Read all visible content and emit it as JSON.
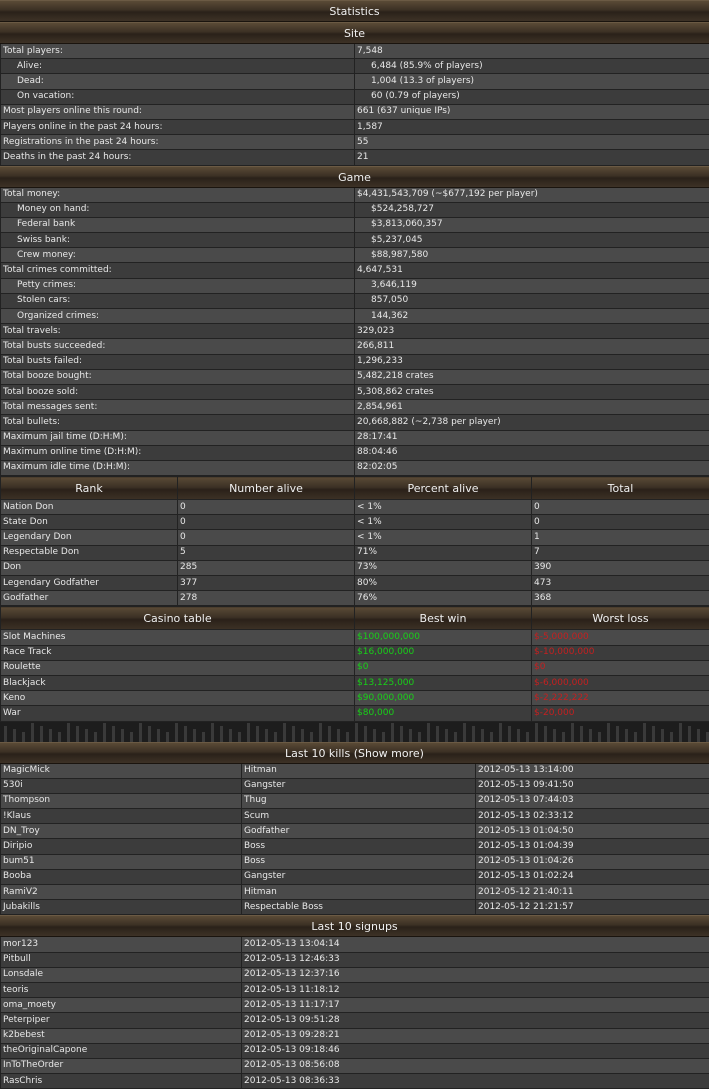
{
  "title": "Statistics",
  "site": {
    "header": "Site",
    "rows": [
      {
        "label": "Total players:",
        "value": "7,548",
        "indent": false
      },
      {
        "label": "Alive:",
        "value": "6,484 (85.9% of players)",
        "indent": true
      },
      {
        "label": "Dead:",
        "value": "1,004 (13.3 of players)",
        "indent": true
      },
      {
        "label": "On vacation:",
        "value": "60 (0.79 of players)",
        "indent": true
      },
      {
        "label": "Most players online this round:",
        "value": "661 (637 unique IPs)",
        "indent": false
      },
      {
        "label": "Players online in the past 24 hours:",
        "value": "1,587",
        "indent": false
      },
      {
        "label": "Registrations in the past 24 hours:",
        "value": "55",
        "indent": false
      },
      {
        "label": "Deaths in the past 24 hours:",
        "value": "21",
        "indent": false
      }
    ]
  },
  "game": {
    "header": "Game",
    "rows": [
      {
        "label": "Total money:",
        "value": "$4,431,543,709 (~$677,192 per player)",
        "indent": false
      },
      {
        "label": "Money on hand:",
        "value": "$524,258,727",
        "indent": true
      },
      {
        "label": "Federal bank",
        "value": "$3,813,060,357",
        "indent": true
      },
      {
        "label": "Swiss bank:",
        "value": "$5,237,045",
        "indent": true
      },
      {
        "label": "Crew money:",
        "value": "$88,987,580",
        "indent": true
      },
      {
        "label": "Total crimes committed:",
        "value": "4,647,531",
        "indent": false
      },
      {
        "label": "Petty crimes:",
        "value": "3,646,119",
        "indent": true
      },
      {
        "label": "Stolen cars:",
        "value": "857,050",
        "indent": true
      },
      {
        "label": "Organized crimes:",
        "value": "144,362",
        "indent": true
      },
      {
        "label": "Total travels:",
        "value": "329,023",
        "indent": false
      },
      {
        "label": "Total busts succeeded:",
        "value": "266,811",
        "indent": false
      },
      {
        "label": "Total busts failed:",
        "value": "1,296,233",
        "indent": false
      },
      {
        "label": "Total booze bought:",
        "value": "5,482,218 crates",
        "indent": false
      },
      {
        "label": "Total booze sold:",
        "value": "5,308,862 crates",
        "indent": false
      },
      {
        "label": "Total messages sent:",
        "value": "2,854,961",
        "indent": false
      },
      {
        "label": "Total bullets:",
        "value": "20,668,882 (~2,738 per player)",
        "indent": false
      },
      {
        "label": "Maximum jail time (D:H:M):",
        "value": "28:17:41",
        "indent": false
      },
      {
        "label": "Maximum online time (D:H:M):",
        "value": "88:04:46",
        "indent": false
      },
      {
        "label": "Maximum idle time (D:H:M):",
        "value": "82:02:05",
        "indent": false
      }
    ]
  },
  "rank": {
    "headers": [
      "Rank",
      "Number alive",
      "Percent alive",
      "Total"
    ],
    "rows": [
      [
        "Nation Don",
        "0",
        "< 1%",
        "0"
      ],
      [
        "State Don",
        "0",
        "< 1%",
        "0"
      ],
      [
        "Legendary Don",
        "0",
        "< 1%",
        "1"
      ],
      [
        "Respectable Don",
        "5",
        "71%",
        "7"
      ],
      [
        "Don",
        "285",
        "73%",
        "390"
      ],
      [
        "Legendary Godfather",
        "377",
        "80%",
        "473"
      ],
      [
        "Godfather",
        "278",
        "76%",
        "368"
      ]
    ]
  },
  "casino": {
    "headers": [
      "Casino table",
      "Best win",
      "Worst loss"
    ],
    "rows": [
      [
        "Slot Machines",
        "$100,000,000",
        "$-5,000,000"
      ],
      [
        "Race Track",
        "$16,000,000",
        "$-10,000,000"
      ],
      [
        "Roulette",
        "$0",
        "$0"
      ],
      [
        "Blackjack",
        "$13,125,000",
        "$-6,000,000"
      ],
      [
        "Keno",
        "$90,000,000",
        "$-2,222,222"
      ],
      [
        "War",
        "$80,000",
        "$-20,000"
      ]
    ],
    "colors": {
      "win": "#18d018",
      "loss": "#c42020"
    }
  },
  "kills": {
    "header": "Last 10 kills (Show more)",
    "rows": [
      [
        "MagicMick",
        "Hitman",
        "2012-05-13 13:14:00"
      ],
      [
        "530i",
        "Gangster",
        "2012-05-13 09:41:50"
      ],
      [
        "Thompson",
        "Thug",
        "2012-05-13 07:44:03"
      ],
      [
        "!Klaus",
        "Scum",
        "2012-05-13 02:33:12"
      ],
      [
        "DN_Troy",
        "Godfather",
        "2012-05-13 01:04:50"
      ],
      [
        "Diripio",
        "Boss",
        "2012-05-13 01:04:39"
      ],
      [
        "bum51",
        "Boss",
        "2012-05-13 01:04:26"
      ],
      [
        "Booba",
        "Gangster",
        "2012-05-13 01:02:24"
      ],
      [
        "RamiV2",
        "Hitman",
        "2012-05-12 21:40:11"
      ],
      [
        "Jubakills",
        "Respectable Boss",
        "2012-05-12 21:21:57"
      ]
    ]
  },
  "signups": {
    "header": "Last 10 signups",
    "rows": [
      [
        "mor123",
        "2012-05-13 13:04:14"
      ],
      [
        "Pitbull",
        "2012-05-13 12:46:33"
      ],
      [
        "Lonsdale",
        "2012-05-13 12:37:16"
      ],
      [
        "teoris",
        "2012-05-13 11:18:12"
      ],
      [
        "oma_moety",
        "2012-05-13 11:17:17"
      ],
      [
        "Peterpiper",
        "2012-05-13 09:51:28"
      ],
      [
        "k2bebest",
        "2012-05-13 09:28:21"
      ],
      [
        "theOriginalCapone",
        "2012-05-13 09:18:46"
      ],
      [
        "InToTheOrder",
        "2012-05-13 08:56:08"
      ],
      [
        "RasChris",
        "2012-05-13 08:36:33"
      ]
    ]
  }
}
